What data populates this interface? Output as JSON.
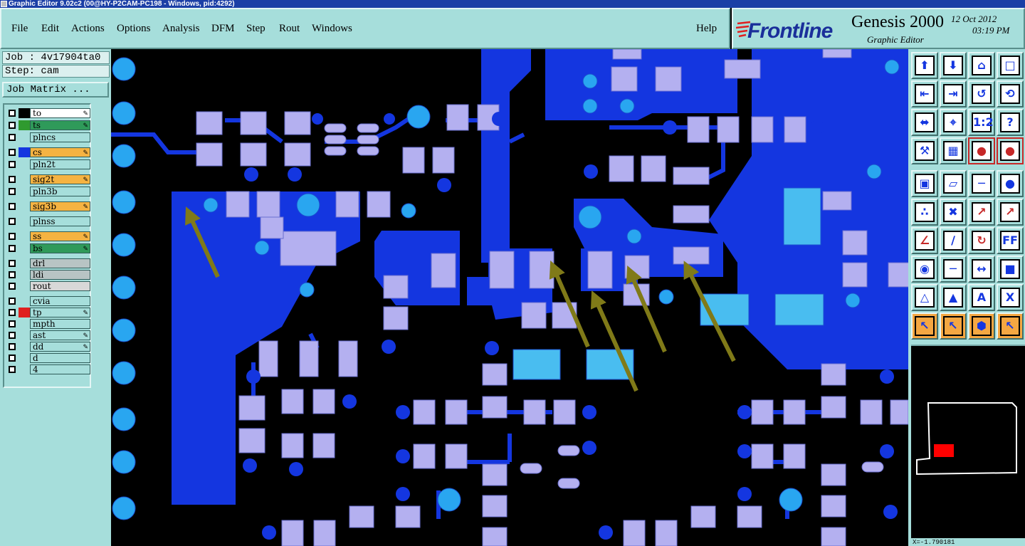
{
  "window": {
    "title": "Graphic Editor 9.02c2 (00@HY-P2CAM-PC198 - Windows, pid:4292)"
  },
  "menu": {
    "items": [
      "File",
      "Edit",
      "Actions",
      "Options",
      "Analysis",
      "DFM",
      "Step",
      "Rout",
      "Windows"
    ],
    "help": "Help"
  },
  "logo": {
    "brand": "Frontline",
    "product": "Genesis 2000",
    "subtitle": "Graphic Editor",
    "date": "12 Oct 2012",
    "time": "03:19 PM"
  },
  "job": {
    "label": "Job : 4v17904ta0",
    "step": "Step: cam",
    "matrix_button": "Job Matrix ..."
  },
  "layers": [
    {
      "name": "to",
      "bg": "#ffffff",
      "chip": "#000000",
      "pen": true
    },
    {
      "name": "ts",
      "bg": "#2f9a5a",
      "chip": "#2f9a2f",
      "pen": true
    },
    {
      "name": "plncs",
      "bg": "#a6dedb",
      "chip": "",
      "pen": false
    },
    {
      "name": "cs",
      "bg": "#f5b342",
      "chip": "#1436e0",
      "pen": true
    },
    {
      "name": "pln2t",
      "bg": "#a6dedb",
      "chip": "",
      "pen": false
    },
    {
      "name": "sig2t",
      "bg": "#f5b342",
      "chip": "",
      "pen": true
    },
    {
      "name": "pln3b",
      "bg": "#a6dedb",
      "chip": "",
      "pen": false
    },
    {
      "name": "sig3b",
      "bg": "#f5b342",
      "chip": "",
      "pen": true
    },
    {
      "name": "plnss",
      "bg": "#a6dedb",
      "chip": "",
      "pen": false
    },
    {
      "name": "ss",
      "bg": "#f5b342",
      "chip": "",
      "pen": true
    },
    {
      "name": "bs",
      "bg": "#2f9a5a",
      "chip": "",
      "pen": true
    },
    {
      "name": "drl",
      "bg": "#b8c4c4",
      "chip": "",
      "pen": false
    },
    {
      "name": "ldi",
      "bg": "#b8c4c4",
      "chip": "",
      "pen": false
    },
    {
      "name": "rout",
      "bg": "#d8d8d8",
      "chip": "",
      "pen": false
    },
    {
      "name": "cvia",
      "bg": "#a6dedb",
      "chip": "",
      "pen": false
    },
    {
      "name": "tp",
      "bg": "#a6dedb",
      "chip": "#e02020",
      "pen": true
    },
    {
      "name": "mpth",
      "bg": "#a6dedb",
      "chip": "",
      "pen": false
    },
    {
      "name": "ast",
      "bg": "#a6dedb",
      "chip": "",
      "pen": true
    },
    {
      "name": "dd",
      "bg": "#a6dedb",
      "chip": "",
      "pen": true
    },
    {
      "name": "d",
      "bg": "#a6dedb",
      "chip": "",
      "pen": false
    },
    {
      "name": "4",
      "bg": "#a6dedb",
      "chip": "",
      "pen": false
    }
  ],
  "tools": [
    "zoom-home-icon",
    "zoom-in-icon",
    "home-icon",
    "zoom-window-icon",
    "pan-left-icon",
    "pan-right-icon",
    "mirror-icon",
    "rotate-icon",
    "fit-icon",
    "center-icon",
    "scale-1-2-icon",
    "help-icon",
    "tools-icon",
    "grid-icon",
    "net-red-icon",
    "net-red2-icon",
    "select-pad-icon",
    "polygon-icon",
    "ruler-icon",
    "dot-icon",
    "connect-icon",
    "cross-icon",
    "arrow-red-icon",
    "arrow-red2-icon",
    "angle-icon",
    "line-icon",
    "undo-arc-icon",
    "ff-icon",
    "pad-icon",
    "minus-icon",
    "measure-icon",
    "feature-icon",
    "triangle-icon",
    "triangle-up-icon",
    "triangle-a-icon",
    "triangle-x-icon",
    "select-icon",
    "select-box-icon",
    "select-octagon-icon",
    "select-net-icon"
  ],
  "status": "X=-1.790181 "
}
